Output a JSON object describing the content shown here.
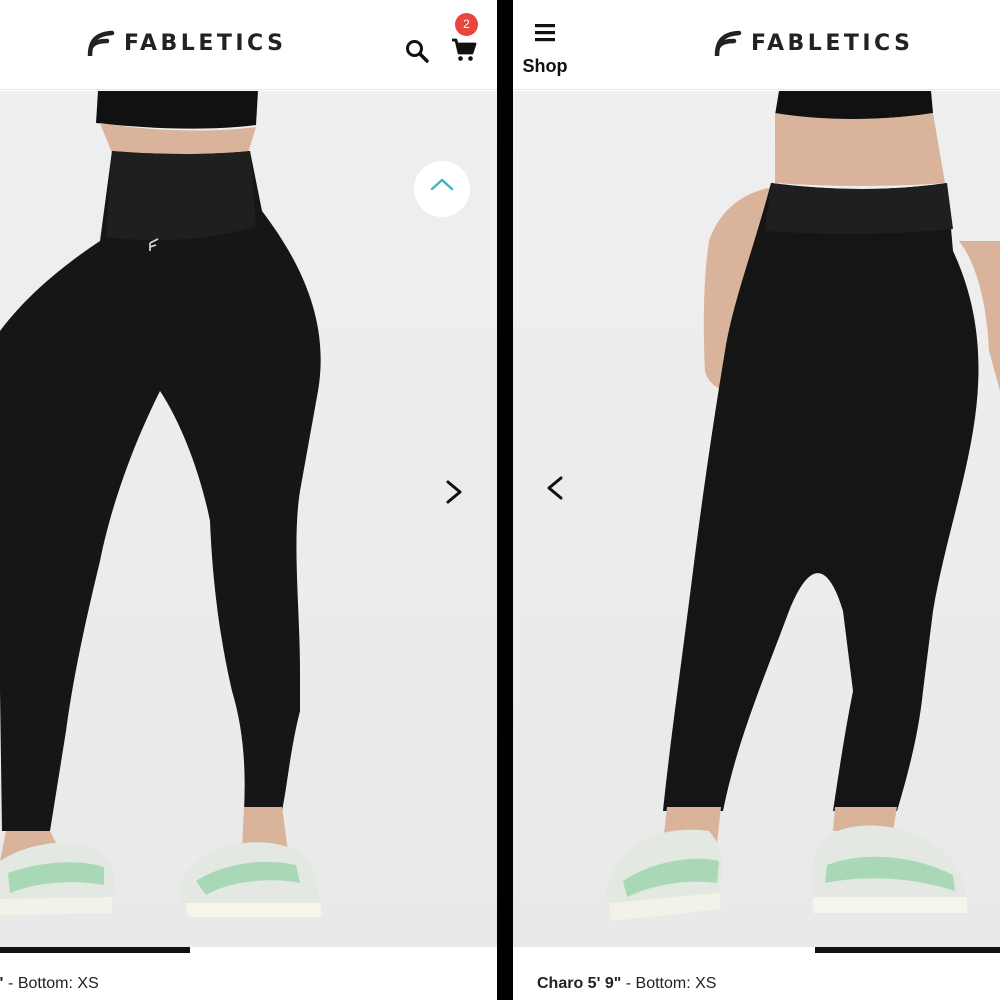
{
  "brand": {
    "name": "FABLETICS"
  },
  "left_panel": {
    "cart_count": "2",
    "caption": {
      "name_tail": "\"",
      "size": "- Bottom: XS"
    },
    "icons": [
      "search-icon",
      "cart-icon",
      "heart-icon",
      "chevron-right-icon"
    ]
  },
  "right_panel": {
    "shop_label": "Shop",
    "caption": {
      "name": "Charo 5' 9\"",
      "size": "- Bottom: XS"
    },
    "icons": [
      "menu-icon",
      "chevron-left-icon"
    ]
  },
  "colors": {
    "accent_badge": "#e8453c",
    "brand_text": "#222222",
    "wishlist_icon": "#3cb4c4"
  }
}
